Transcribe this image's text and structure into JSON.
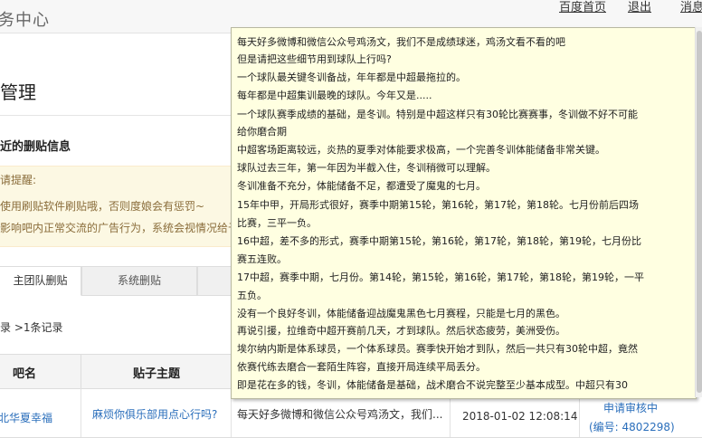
{
  "header": {
    "brand": "务中心",
    "nav": [
      "百度首页",
      "退出",
      "消息"
    ]
  },
  "page": {
    "section_title": "管理",
    "sub_heading": "近的删贴信息"
  },
  "notice": {
    "lines": [
      "请提醒:",
      "使用刷贴软件刷贴哦，否则度娘会有惩罚~",
      "影响吧内正常交流的广告行为，系统会视情况给予"
    ]
  },
  "tabs": {
    "active": "主团队删贴",
    "system": "系统删贴"
  },
  "record_count": "录 >1条记录",
  "table": {
    "headers": [
      "吧名",
      "贴子主题"
    ],
    "row": {
      "forum": "北华夏幸福",
      "topic": "麻烦你俱乐部用点心行吗?",
      "content": "每天好多微博和微信公众号鸡汤文，我们...",
      "time": "2018-01-02 12:08:14",
      "status": "申请审核中",
      "serial": "(编号: 4802298)"
    }
  },
  "tooltip": {
    "lines": [
      "每天好多微博和微信公众号鸡汤文，我们不是成绩球迷，鸡汤文看不看的吧",
      "但是请把这些细节用到球队上行吗?",
      "一个球队最关键冬训备战，年年都是中超最拖拉的。",
      "每年都是中超集训最晚的球队。今年又是.....",
      "一个球队赛季成绩的基础，是冬训。特别是中超这样只有30轮比赛赛事，冬训做不好不可能",
      "给你磨合期",
      "中超客场距离较远，炎热的夏季对体能要求极高，一个完善冬训体能储备非常关键。",
      "球队过去三年，第一年因为半截入住，冬训稍微可以理解。",
      "冬训准备不充分，体能储备不足，都遭受了魔鬼的七月。",
      "15年中甲，开局形式很好，赛季中期第15轮，第16轮，第17轮，第18轮。七月份前后四场",
      "比赛，三平一负。",
      "16中超，差不多的形式，赛季中期第15轮，第16轮，第17轮，第18轮，第19轮，七月份比",
      "赛五连败。",
      "17中超，赛季中期，七月份。第14轮，第15轮，第16轮，第17轮，第18轮，第19轮，一平",
      "五负。",
      "没有一个良好冬训，体能储备迎战魔鬼黑色七月赛程，只能是七月的黑色。",
      "再说引援，拉维奇中超开赛前几天，才到球队。然后状态疲劳，美洲受伤。",
      "埃尔纳内斯是体系球员，一个体系球员。赛季快开始才到队，然后一共只有30轮中超，竟然",
      "依赛代练去磨合一套陌生阵容，直接开局连续平局丢分。",
      "即是花在多的钱，冬训，体能储备是基础，战术磨合不说完整至少基本成型。中超只有30"
    ]
  }
}
